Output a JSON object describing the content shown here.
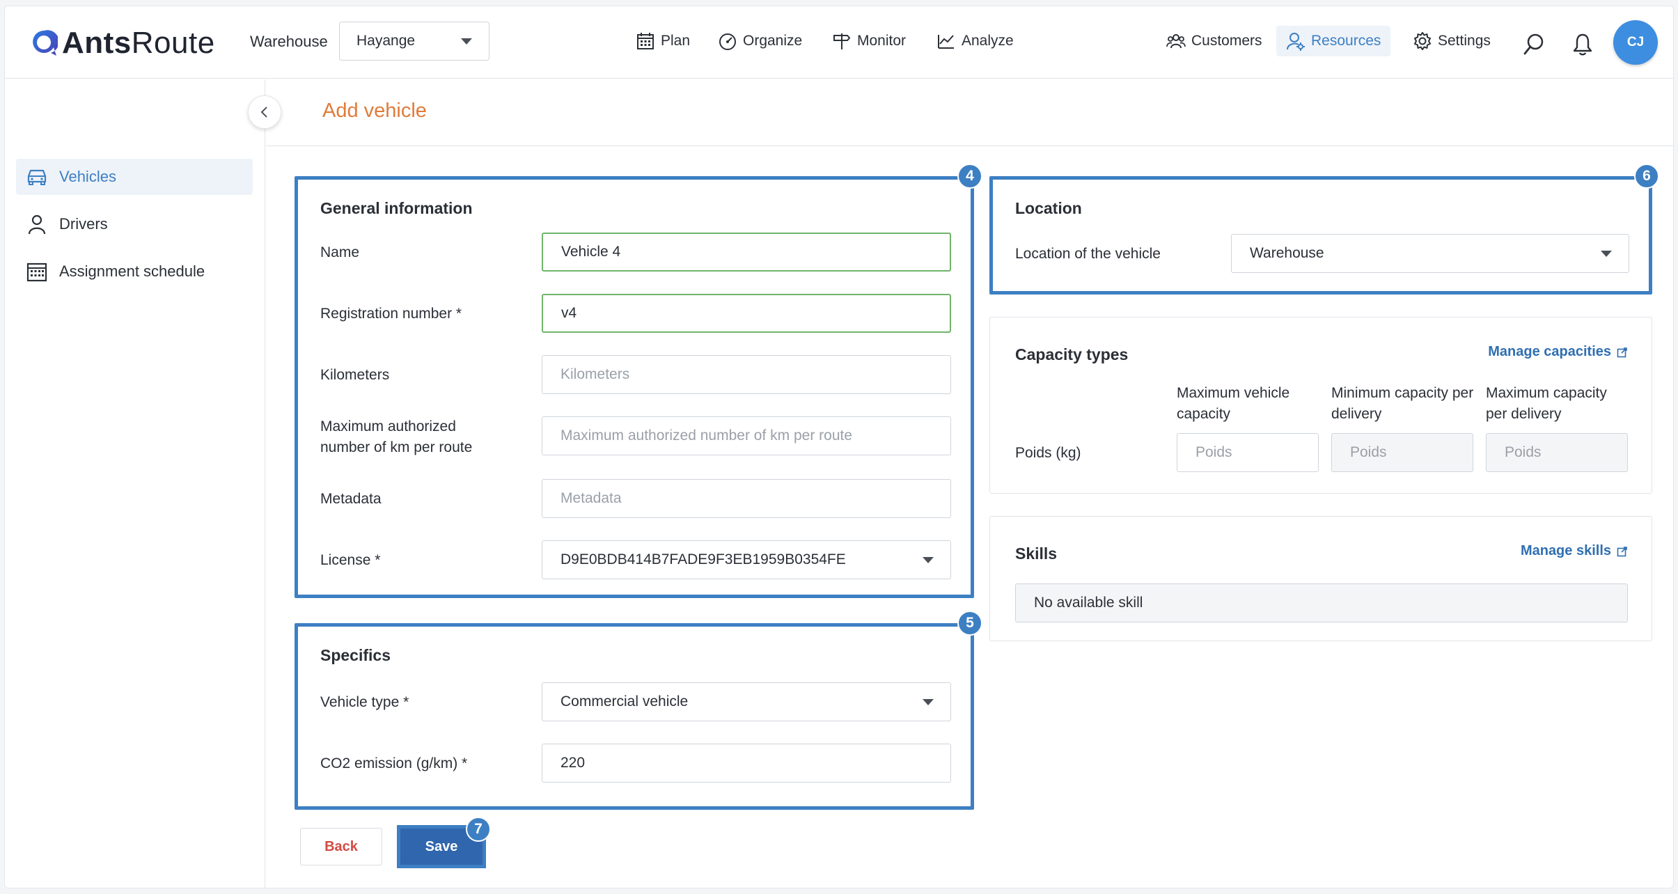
{
  "brand": {
    "name_bold": "Ants",
    "name_light": "Route"
  },
  "warehouse": {
    "label": "Warehouse",
    "selected": "Hayange"
  },
  "nav": [
    {
      "label": "Plan",
      "icon": "calendar-icon"
    },
    {
      "label": "Organize",
      "icon": "gauge-icon"
    },
    {
      "label": "Monitor",
      "icon": "signpost-icon"
    },
    {
      "label": "Analyze",
      "icon": "chart-icon"
    }
  ],
  "right_nav": [
    {
      "label": "Customers",
      "icon": "users-icon"
    },
    {
      "label": "Resources",
      "icon": "resources-icon",
      "active": true
    },
    {
      "label": "Settings",
      "icon": "gear-icon"
    }
  ],
  "user": {
    "initials": "CJ"
  },
  "sidebar": {
    "items": [
      {
        "label": "Vehicles",
        "active": true
      },
      {
        "label": "Drivers"
      },
      {
        "label": "Assignment schedule"
      }
    ]
  },
  "page": {
    "title": "Add vehicle"
  },
  "general": {
    "badge": "4",
    "title": "General information",
    "name_label": "Name",
    "name_value": "Vehicle 4",
    "reg_label": "Registration number *",
    "reg_value": "v4",
    "km_label": "Kilometers",
    "km_placeholder": "Kilometers",
    "maxkm_label": "Maximum authorized number of km per route",
    "maxkm_placeholder": "Maximum authorized number of km per route",
    "meta_label": "Metadata",
    "meta_placeholder": "Metadata",
    "license_label": "License *",
    "license_value": "D9E0BDB414B7FADE9F3EB1959B0354FE"
  },
  "specifics": {
    "badge": "5",
    "title": "Specifics",
    "type_label": "Vehicle type *",
    "type_value": "Commercial vehicle",
    "co2_label": "CO2 emission (g/km) *",
    "co2_value": "220"
  },
  "location": {
    "badge": "6",
    "title": "Location",
    "label": "Location of the vehicle",
    "value": "Warehouse"
  },
  "capacity": {
    "title": "Capacity types",
    "manage_label": "Manage capacities",
    "col_max_vehicle": "Maximum vehicle capacity",
    "col_min_delivery": "Minimum capacity per delivery",
    "col_max_delivery": "Maximum capacity per delivery",
    "row_label": "Poids (kg)",
    "placeholder": "Poids"
  },
  "skills": {
    "title": "Skills",
    "manage_label": "Manage skills",
    "empty": "No available skill"
  },
  "actions": {
    "back": "Back",
    "save": "Save",
    "save_badge": "7"
  },
  "colors": {
    "accent": "#3d7fc3",
    "title": "#e07b3a",
    "back": "#d24b43",
    "save": "#2f66ad",
    "valid": "#6fb56a"
  }
}
